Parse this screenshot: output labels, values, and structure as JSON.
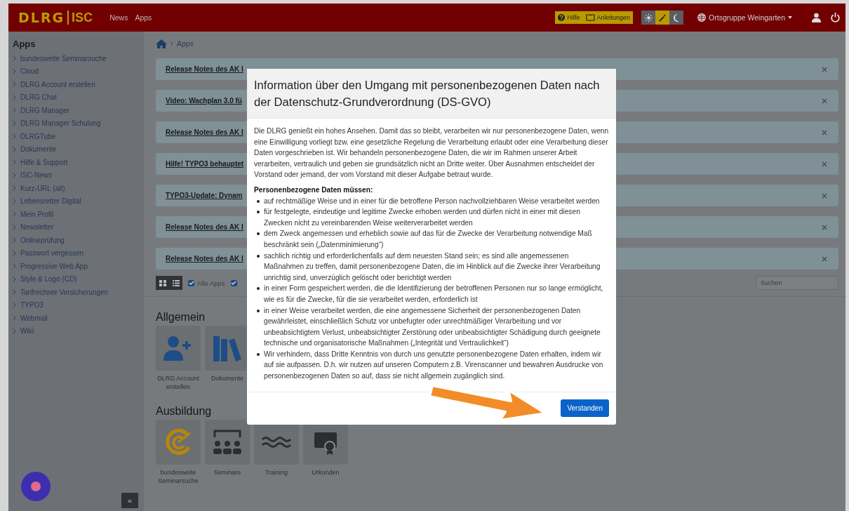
{
  "topbar": {
    "logo_left": "DLRG",
    "logo_right": "ISC",
    "nav": [
      "News",
      "Apps"
    ],
    "help": "Hilfe",
    "guides": "Anleitungen",
    "theme_buttons": [
      {
        "kind": "sun",
        "selected": false
      },
      {
        "kind": "wand",
        "selected": true
      },
      {
        "kind": "moon",
        "selected": false
      }
    ],
    "organization": "Ortsgruppe Weingarten"
  },
  "sidebar": {
    "title": "Apps",
    "items": [
      "bundesweite Seminarsuche",
      "Cloud",
      "DLRG Account erstellen",
      "DLRG Chat",
      "DLRG Manager",
      "DLRG Manager Schulung",
      "DLRGTube",
      "Dokumente",
      "Hilfe & Support",
      "ISC-News",
      "Kurz-URL (alt)",
      "Lebensretter Digital",
      "Mein Profil",
      "Newsletter",
      "Onlineprüfung",
      "Passwort vergessen",
      "Progressive Web App",
      "Style & Logo (CD)",
      "Tarifrechner Versicherungen",
      "TYPO3",
      "Webmail",
      "Wiki"
    ],
    "collapse": "«"
  },
  "breadcrumb": [
    "Apps"
  ],
  "alerts": [
    "Release Notes des AK I",
    "Video: Wachplan 3.0 fü",
    "Release Notes des AK I",
    "Hilfe! TYPO3 behauptet",
    "TYPO3-Update: Dynam",
    "Release Notes des AK I",
    "Release Notes des AK I"
  ],
  "filters": [
    {
      "label": "Alle Apps",
      "checked": true
    },
    {
      "checked": true
    }
  ],
  "search": {
    "placeholder": "Suchen"
  },
  "sections": [
    {
      "title": "Allgemein",
      "tiles": [
        {
          "kind": "account",
          "label": "DLRG Account erstellen"
        },
        {
          "kind": "documents",
          "label": "Dokumente"
        }
      ]
    },
    {
      "title": "Ausbildung",
      "tiles": [
        {
          "kind": "target",
          "label": "bundesweite Seminarsuche"
        },
        {
          "kind": "seminar",
          "label": "Seminare"
        },
        {
          "kind": "training",
          "label": "Training"
        },
        {
          "kind": "certificate",
          "label": "Urkunden"
        }
      ]
    }
  ],
  "modal": {
    "title": "Information über den Umgang mit personenbezogenen Daten nach der Datenschutz-Grundverordnung (DS-GVO)",
    "intro": "Die DLRG genießt ein hohes Ansehen. Damit das so bleibt, verarbeiten wir nur personenbezogene Daten, wenn eine Einwilligung vorliegt bzw. eine gesetzliche Regelung die Verarbeitung erlaubt oder eine Verarbeitung dieser Daten vorgeschrieben ist. Wir behandeln personenbezogene Daten, die wir im Rahmen unserer Arbeit verarbeiten, vertraulich und geben sie grundsätzlich nicht an Dritte weiter. Über Ausnahmen entscheidet der Vorstand oder jemand, der vom Vorstand mit dieser Aufgabe betraut wurde.",
    "list_title": "Personenbezogene Daten müssen:",
    "items": [
      "auf rechtmäßige Weise und in einer für die betroffene Person nachvollziehbaren Weise verarbeitet werden",
      "für festgelegte, eindeutige und legitime Zwecke erhoben werden und dürfen nicht in einer mit diesen Zwecken nicht zu vereinbarenden Weise weiterverarbeitet werden",
      "dem Zweck angemessen und erheblich sowie auf das für die Zwecke der Verarbeitung notwendige Maß beschränkt sein („Datenminimierung“)",
      "sachlich richtig und erforderlichenfalls auf dem neuesten Stand sein; es sind alle angemessenen Maßnahmen zu treffen, damit personenbezogene Daten, die im Hinblick auf die Zwecke ihrer Verarbeitung unrichtig sind, unverzüglich gelöscht oder berichtigt werden",
      "in einer Form gespeichert werden, die die Identifizierung der betroffenen Personen nur so lange ermöglicht, wie es für die Zwecke, für die sie verarbeitet werden, erforderlich ist",
      "in einer Weise verarbeitet werden, die eine angemessene Sicherheit der personenbezogenen Daten gewährleistet, einschließlich Schutz vor unbefugter oder unrechtmäßiger Verarbeitung und vor unbeabsichtigtem Verlust, unbeabsichtigter Zerstörung oder unbeabsichtigter Schädigung durch geeignete technische und organisatorische Maßnahmen („Integrität und Vertraulichkeit“)",
      "Wir verhindern, dass Dritte Kenntnis von durch uns genutzte personenbezogene Daten erhalten, indem wir auf sie aufpassen. D.h. wir nutzen auf unseren Computern z.B. Virenscanner und bewahren Ausdrucke von personenbezogenen Daten so auf, dass sie nicht allgemein zugänglich sind."
    ],
    "button": "Verstanden"
  }
}
